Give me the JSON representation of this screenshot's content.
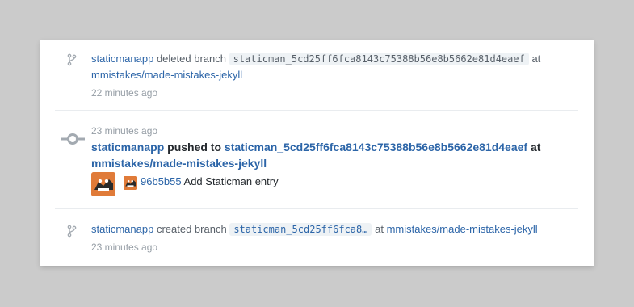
{
  "events": [
    {
      "type": "branch-deleted",
      "icon": "git-branch-icon",
      "actor": "staticmanapp",
      "action": "deleted branch",
      "branch": "staticman_5cd25ff6fca8143c75388b56e8b5662e81d4eaef",
      "at": "at",
      "repo": "mmistakes/made-mistakes-jekyll",
      "time": "22 minutes ago"
    },
    {
      "type": "push",
      "icon": "git-commit-icon",
      "time": "23 minutes ago",
      "actor": "staticmanapp",
      "action": "pushed to",
      "branch": "staticman_5cd25ff6fca8143c75388b56e8b5662e81d4eaef",
      "at": "at",
      "repo": "mmistakes/made-mistakes-jekyll",
      "commit": {
        "sha": "96b5b55",
        "message": "Add Staticman entry"
      }
    },
    {
      "type": "branch-created",
      "icon": "git-branch-icon",
      "actor": "staticmanapp",
      "action": "created branch",
      "branch": "staticman_5cd25ff6fca8…",
      "at": "at",
      "repo": "mmistakes/made-mistakes-jekyll",
      "time": "23 minutes ago"
    }
  ],
  "colors": {
    "link": "#2c65a8",
    "muted": "#959da5",
    "code_bg": "#eef2f5",
    "avatar": "#e07b39",
    "background": "#cbcbcb"
  }
}
